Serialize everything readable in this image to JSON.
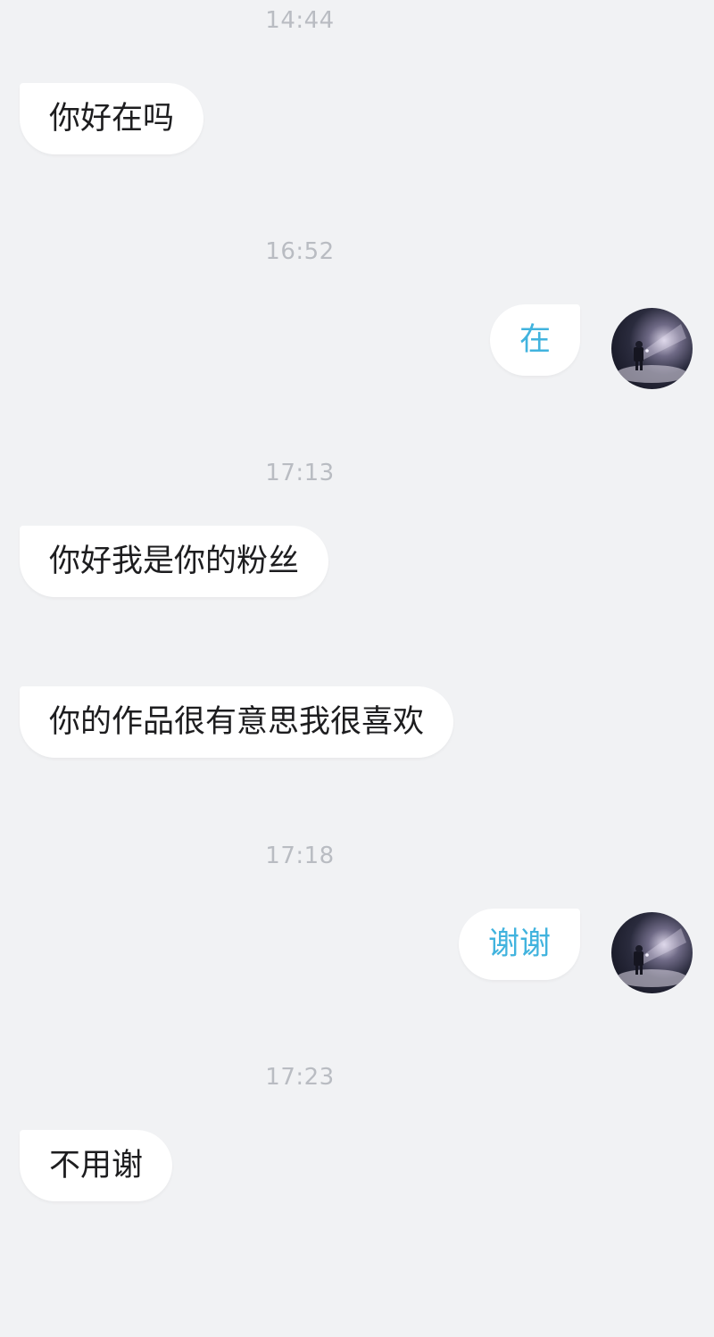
{
  "conversation": {
    "messages": [
      {
        "timestamp": "14:44",
        "side": "incoming",
        "text": "你好在吗"
      },
      {
        "timestamp": "16:52",
        "side": "outgoing",
        "text": "在"
      },
      {
        "timestamp": "17:13",
        "side": "incoming",
        "text": "你好我是你的粉丝"
      },
      {
        "timestamp": "",
        "side": "incoming",
        "text": "你的作品很有意思我很喜欢"
      },
      {
        "timestamp": "17:18",
        "side": "outgoing",
        "text": "谢谢"
      },
      {
        "timestamp": "17:23",
        "side": "incoming",
        "text": "不用谢"
      }
    ]
  },
  "colors": {
    "background": "#f1f2f4",
    "bubble": "#ffffff",
    "incoming_text": "#1d1d1f",
    "outgoing_text": "#41b3de",
    "timestamp_text": "#b9bcc2"
  },
  "icons": {
    "avatar": "astronaut-avatar-icon"
  }
}
